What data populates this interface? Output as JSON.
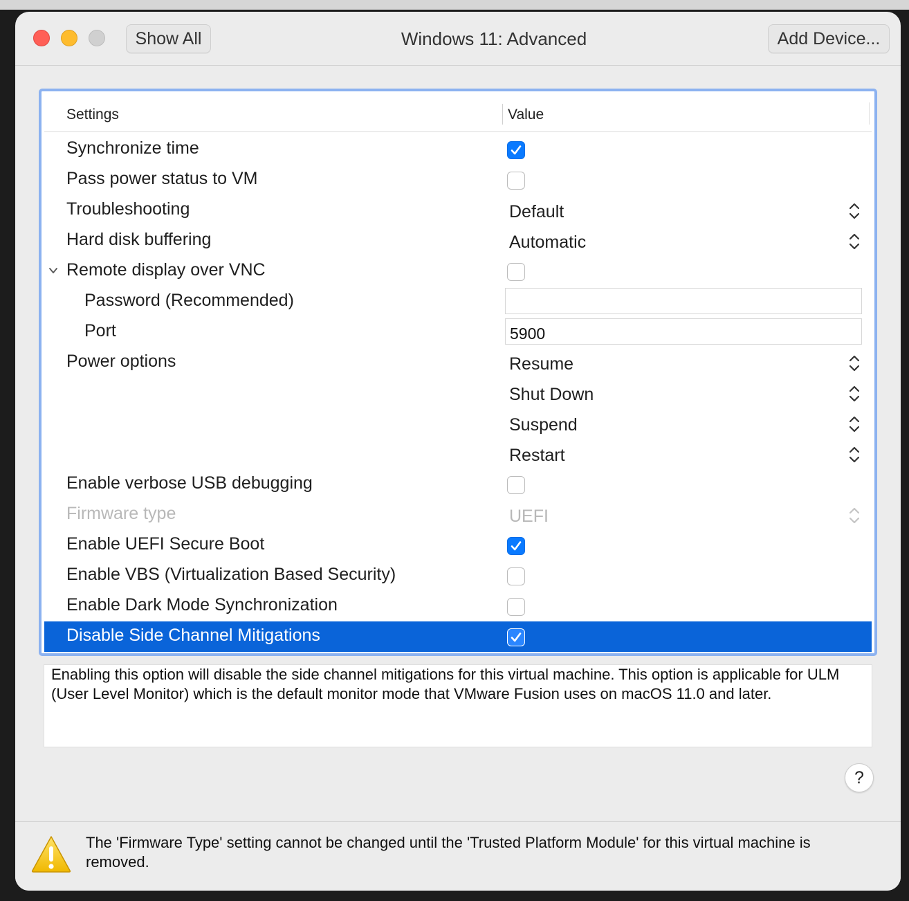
{
  "window": {
    "title": "Windows 11: Advanced",
    "show_all_label": "Show All",
    "add_device_label": "Add Device..."
  },
  "table": {
    "headers": {
      "settings": "Settings",
      "value": "Value"
    },
    "rows": [
      {
        "label": "Synchronize time",
        "control": "checkbox",
        "checked": true
      },
      {
        "label": "Pass power status to VM",
        "control": "checkbox",
        "checked": false
      },
      {
        "label": "Troubleshooting",
        "control": "popup",
        "value": "Default"
      },
      {
        "label": "Hard disk buffering",
        "control": "popup",
        "value": "Automatic"
      },
      {
        "label": "Remote display over VNC",
        "control": "checkbox",
        "checked": false,
        "expanded": true
      },
      {
        "label": "Password (Recommended)",
        "control": "textfield",
        "value": "",
        "indent": true
      },
      {
        "label": "Port",
        "control": "textfield",
        "value": "5900",
        "indent": true
      },
      {
        "label": "Power options",
        "control": "popup",
        "value": "Resume"
      },
      {
        "label": "",
        "control": "popup",
        "value": "Shut Down"
      },
      {
        "label": "",
        "control": "popup",
        "value": "Suspend"
      },
      {
        "label": "",
        "control": "popup",
        "value": "Restart"
      },
      {
        "label": "Enable verbose USB debugging",
        "control": "checkbox",
        "checked": false
      },
      {
        "label": "Firmware type",
        "control": "popup",
        "value": "UEFI",
        "disabled": true
      },
      {
        "label": "Enable UEFI Secure Boot",
        "control": "checkbox",
        "checked": true
      },
      {
        "label": "Enable VBS (Virtualization Based Security)",
        "control": "checkbox",
        "checked": false
      },
      {
        "label": "Enable Dark Mode Synchronization",
        "control": "checkbox",
        "checked": false
      },
      {
        "label": "Disable Side Channel Mitigations",
        "control": "checkbox",
        "checked": true,
        "selected": true
      }
    ]
  },
  "description": "Enabling this option will disable the side channel mitigations for this virtual machine. This option is applicable for ULM (User Level Monitor) which is the default monitor mode that VMware Fusion uses on macOS 11.0 and later.",
  "help_label": "?",
  "footer": {
    "warning_text": "The 'Firmware Type' setting cannot be changed until the 'Trusted Platform Module' for this virtual machine is removed."
  },
  "colors": {
    "selection": "#0a64d9",
    "checkbox_checked": "#0a7aff",
    "focus_ring": "#8cb2f0"
  }
}
